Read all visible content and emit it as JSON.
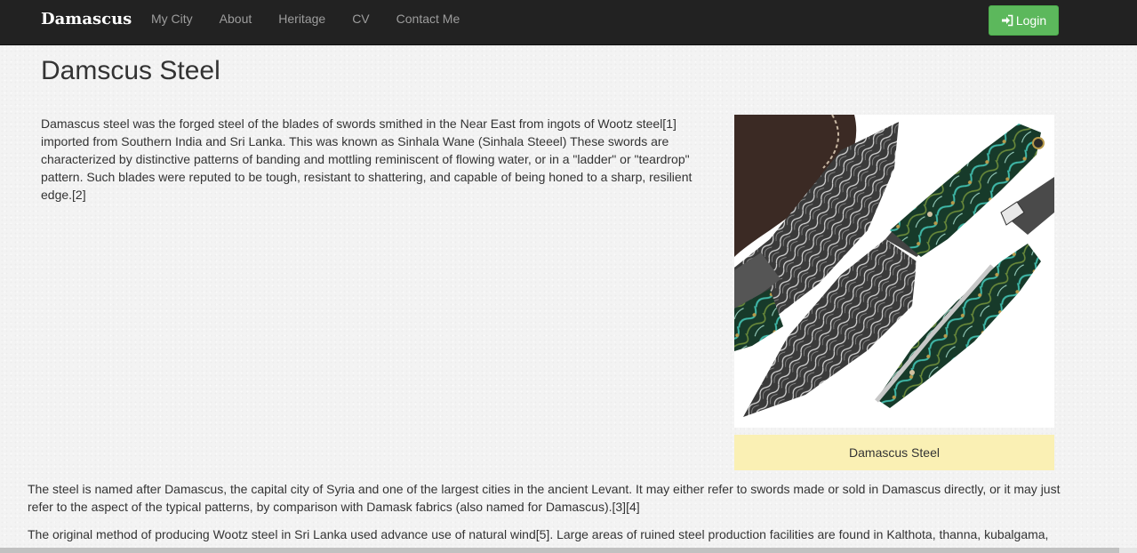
{
  "nav": {
    "brand": "Damascus",
    "links": [
      "My City",
      "About",
      "Heritage",
      "CV",
      "Contact Me"
    ],
    "login_label": "Login",
    "login_icon": "sign-in-icon"
  },
  "page": {
    "title": "Damscus Steel",
    "intro": "Damascus steel was the forged steel of the blades of swords smithed in the Near East from ingots of Wootz steel[1] imported from Southern India and Sri Lanka. This was known as Sinhala Wane (Sinhala Steeel) These swords are characterized by distinctive patterns of banding and mottling reminiscent of flowing water, or in a \"ladder\" or \"teardrop\" pattern. Such blades were reputed to be tough, resistant to shattering, and capable of being honed to a sharp, resilient edge.[2]",
    "figure_caption": "Damascus Steel",
    "paragraphs": [
      "The steel is named after Damascus, the capital city of Syria and one of the largest cities in the ancient Levant. It may either refer to swords made or sold in Damascus directly, or it may just refer to the aspect of the typical patterns, by comparison with Damask fabrics (also named for Damascus).[3][4]",
      "The original method of producing Wootz steel in Sri Lanka used advance use of natural wind[5]. Large areas of ruined steel production facilities are found in Kalthota, thanna, kubalgama,"
    ]
  },
  "colors": {
    "navbar": "#222222",
    "login_button": "#5cb85c",
    "caption_bg": "#faf0b4",
    "handle_green": "#1f5a3c",
    "handle_teal": "#3fb8a8"
  }
}
